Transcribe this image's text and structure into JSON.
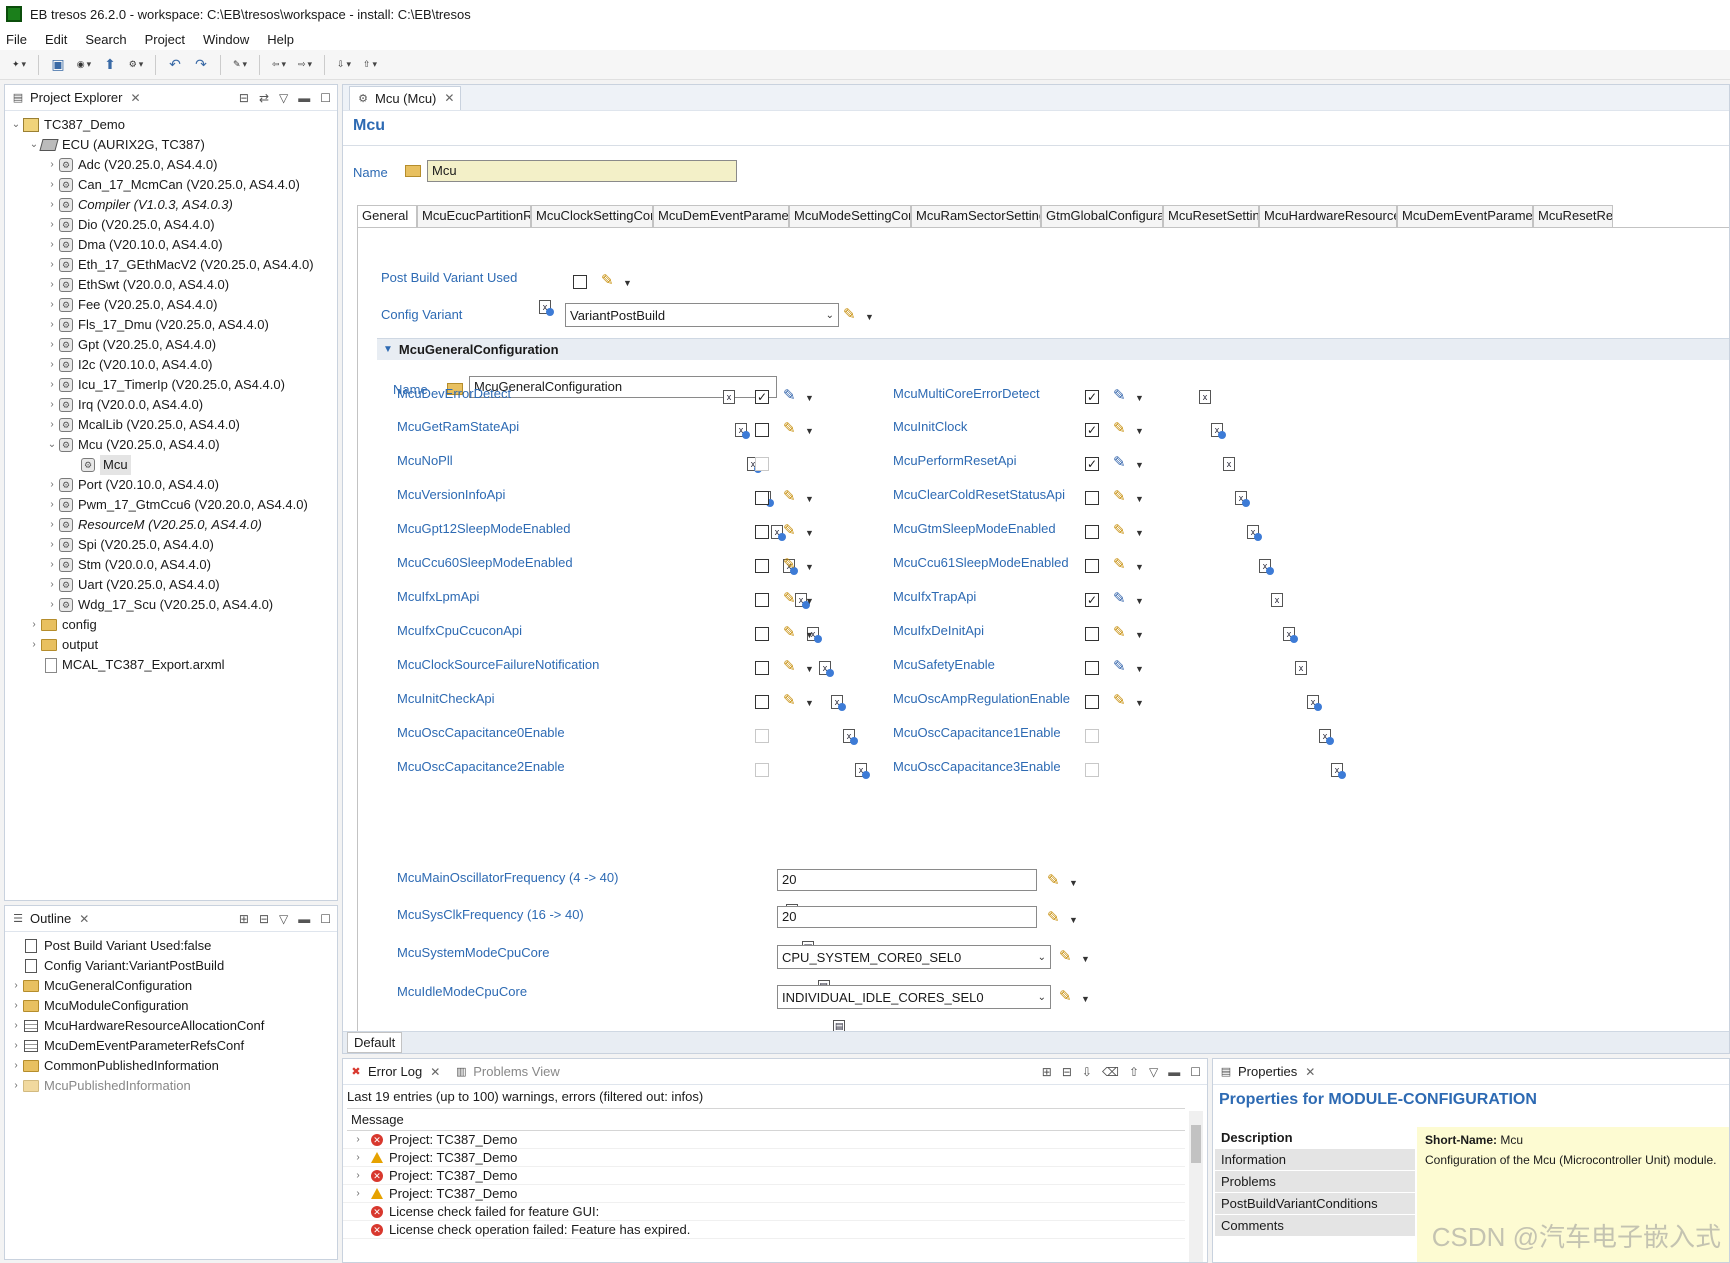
{
  "window": {
    "title": "EB tresos 26.2.0 - workspace: C:\\EB\\tresos\\workspace - install: C:\\EB\\tresos"
  },
  "menu": [
    "File",
    "Edit",
    "Search",
    "Project",
    "Window",
    "Help"
  ],
  "project_explorer": {
    "tab_label": "Project Explorer",
    "project": "TC387_Demo",
    "ecu": "ECU (AURIX2G, TC387)",
    "modules": [
      {
        "label": "Adc (V20.25.0, AS4.4.0)",
        "italic": false
      },
      {
        "label": "Can_17_McmCan (V20.25.0, AS4.4.0)",
        "italic": false
      },
      {
        "label": "Compiler (V1.0.3, AS4.0.3)",
        "italic": true
      },
      {
        "label": "Dio (V20.25.0, AS4.4.0)",
        "italic": false
      },
      {
        "label": "Dma (V20.10.0, AS4.4.0)",
        "italic": false
      },
      {
        "label": "Eth_17_GEthMacV2 (V20.25.0, AS4.4.0)",
        "italic": false
      },
      {
        "label": "EthSwt (V20.0.0, AS4.4.0)",
        "italic": false
      },
      {
        "label": "Fee (V20.25.0, AS4.4.0)",
        "italic": false
      },
      {
        "label": "Fls_17_Dmu (V20.25.0, AS4.4.0)",
        "italic": false
      },
      {
        "label": "Gpt (V20.25.0, AS4.4.0)",
        "italic": false
      },
      {
        "label": "I2c (V20.10.0, AS4.4.0)",
        "italic": false
      },
      {
        "label": "Icu_17_TimerIp (V20.25.0, AS4.4.0)",
        "italic": false
      },
      {
        "label": "Irq (V20.0.0, AS4.4.0)",
        "italic": false
      },
      {
        "label": "McalLib (V20.25.0, AS4.4.0)",
        "italic": false
      },
      {
        "label": "Mcu (V20.25.0, AS4.4.0)",
        "italic": false,
        "expanded": true,
        "child": "Mcu"
      },
      {
        "label": "Port (V20.10.0, AS4.4.0)",
        "italic": false
      },
      {
        "label": "Pwm_17_GtmCcu6 (V20.20.0, AS4.4.0)",
        "italic": false
      },
      {
        "label": "ResourceM (V20.25.0, AS4.4.0)",
        "italic": true
      },
      {
        "label": "Spi (V20.25.0, AS4.4.0)",
        "italic": false
      },
      {
        "label": "Stm (V20.0.0, AS4.4.0)",
        "italic": false
      },
      {
        "label": "Uart (V20.25.0, AS4.4.0)",
        "italic": false
      },
      {
        "label": "Wdg_17_Scu (V20.25.0, AS4.4.0)",
        "italic": false
      }
    ],
    "folders": [
      "config",
      "output"
    ],
    "file": "MCAL_TC387_Export.arxml"
  },
  "outline": {
    "tab_label": "Outline",
    "items": [
      {
        "label": "Post Build Variant Used:false",
        "kind": "param"
      },
      {
        "label": "Config Variant:VariantPostBuild",
        "kind": "param"
      },
      {
        "label": "McuGeneralConfiguration",
        "kind": "folder"
      },
      {
        "label": "McuModuleConfiguration",
        "kind": "folder"
      },
      {
        "label": "McuHardwareResourceAllocationConf",
        "kind": "table"
      },
      {
        "label": "McuDemEventParameterRefsConf",
        "kind": "table"
      },
      {
        "label": "CommonPublishedInformation",
        "kind": "folder"
      },
      {
        "label": "McuPublishedInformation",
        "kind": "folder-gray"
      }
    ]
  },
  "editor": {
    "tab_label": "Mcu (Mcu)",
    "heading": "Mcu",
    "name_label": "Name",
    "name_value": "Mcu",
    "config_tabs": [
      "General",
      "McuEcucPartitionRef",
      "McuClockSettingConfi",
      "McuDemEventParameter",
      "McuModeSettingConf",
      "McuRamSectorSettingC",
      "GtmGlobalConfigurati",
      "McuResetSetting",
      "McuHardwareResourceA",
      "McuDemEventParameter",
      "McuResetRe"
    ],
    "post_build_label": "Post Build Variant Used",
    "config_variant_label": "Config Variant",
    "config_variant_value": "VariantPostBuild",
    "section_title": "McuGeneralConfiguration",
    "section_name_label": "Name",
    "section_name_value": "McuGeneralConfiguration",
    "params_left": [
      {
        "label": "McuDevErrorDetect",
        "checked": true,
        "mode": "lock",
        "enabled": true
      },
      {
        "label": "McuGetRamStateApi",
        "checked": false,
        "mode": "edit",
        "enabled": true
      },
      {
        "label": "McuNoPll",
        "checked": false,
        "mode": "none",
        "enabled": false
      },
      {
        "label": "McuVersionInfoApi",
        "checked": false,
        "mode": "edit",
        "enabled": true
      },
      {
        "label": "McuGpt12SleepModeEnabled",
        "checked": false,
        "mode": "edit",
        "enabled": true
      },
      {
        "label": "McuCcu60SleepModeEnabled",
        "checked": false,
        "mode": "edit",
        "enabled": true
      },
      {
        "label": "McuIfxLpmApi",
        "checked": false,
        "mode": "edit",
        "enabled": true
      },
      {
        "label": "McuIfxCpuCcuconApi",
        "checked": false,
        "mode": "edit",
        "enabled": true
      },
      {
        "label": "McuClockSourceFailureNotification",
        "checked": false,
        "mode": "edit",
        "enabled": true
      },
      {
        "label": "McuInitCheckApi",
        "checked": false,
        "mode": "edit",
        "enabled": true
      },
      {
        "label": "McuOscCapacitance0Enable",
        "checked": false,
        "mode": "none",
        "enabled": false
      },
      {
        "label": "McuOscCapacitance2Enable",
        "checked": false,
        "mode": "none",
        "enabled": false
      }
    ],
    "params_right": [
      {
        "label": "McuMultiCoreErrorDetect",
        "checked": true,
        "mode": "lock",
        "enabled": true
      },
      {
        "label": "McuInitClock",
        "checked": true,
        "mode": "edit",
        "enabled": true
      },
      {
        "label": "McuPerformResetApi",
        "checked": true,
        "mode": "lock",
        "enabled": true
      },
      {
        "label": "McuClearColdResetStatusApi",
        "checked": false,
        "mode": "edit",
        "enabled": true
      },
      {
        "label": "McuGtmSleepModeEnabled",
        "checked": false,
        "mode": "edit",
        "enabled": true
      },
      {
        "label": "McuCcu61SleepModeEnabled",
        "checked": false,
        "mode": "edit",
        "enabled": true
      },
      {
        "label": "McuIfxTrapApi",
        "checked": true,
        "mode": "lock",
        "enabled": true
      },
      {
        "label": "McuIfxDeInitApi",
        "checked": false,
        "mode": "edit",
        "enabled": true
      },
      {
        "label": "McuSafetyEnable",
        "checked": false,
        "mode": "lock",
        "enabled": true
      },
      {
        "label": "McuOscAmpRegulationEnable",
        "checked": false,
        "mode": "edit",
        "enabled": true
      },
      {
        "label": "McuOscCapacitance1Enable",
        "checked": false,
        "mode": "none",
        "enabled": false
      },
      {
        "label": "McuOscCapacitance3Enable",
        "checked": false,
        "mode": "none",
        "enabled": false
      }
    ],
    "main_osc_label": "McuMainOscillatorFrequency (4 -> 40)",
    "main_osc_value": "20",
    "sysclk_label": "McuSysClkFrequency (16 -> 40)",
    "sysclk_value": "20",
    "system_mode_label": "McuSystemModeCpuCore",
    "system_mode_value": "CPU_SYSTEM_CORE0_SEL0",
    "idle_mode_label": "McuIdleModeCpuCore",
    "idle_mode_value": "INDIVIDUAL_IDLE_CORES_SEL0",
    "bottom_tab": "Default"
  },
  "error_log": {
    "tab_label": "Error Log",
    "tab2_label": "Problems View",
    "summary": "Last 19 entries (up to 100) warnings, errors (filtered out: infos)",
    "column": "Message",
    "rows": [
      {
        "text": "Project: TC387_Demo",
        "severity": "error",
        "expandable": true
      },
      {
        "text": "Project: TC387_Demo",
        "severity": "warning",
        "expandable": true
      },
      {
        "text": "Project: TC387_Demo",
        "severity": "error",
        "expandable": true
      },
      {
        "text": "Project: TC387_Demo",
        "severity": "warning",
        "expandable": true
      },
      {
        "text": "License check failed for feature GUI:",
        "severity": "error",
        "expandable": false
      },
      {
        "text": "License check operation failed: Feature has expired.",
        "severity": "error",
        "expandable": false
      }
    ]
  },
  "properties": {
    "tab_label": "Properties",
    "title": "Properties for MODULE-CONFIGURATION",
    "sections": [
      "Description",
      "Information",
      "Problems",
      "PostBuildVariantConditions",
      "Comments"
    ],
    "short_name_label": "Short-Name:",
    "short_name_value": "Mcu",
    "description_text": "Configuration of the Mcu (Microcontroller Unit) module."
  },
  "watermark": "CSDN @汽车电子嵌入式"
}
